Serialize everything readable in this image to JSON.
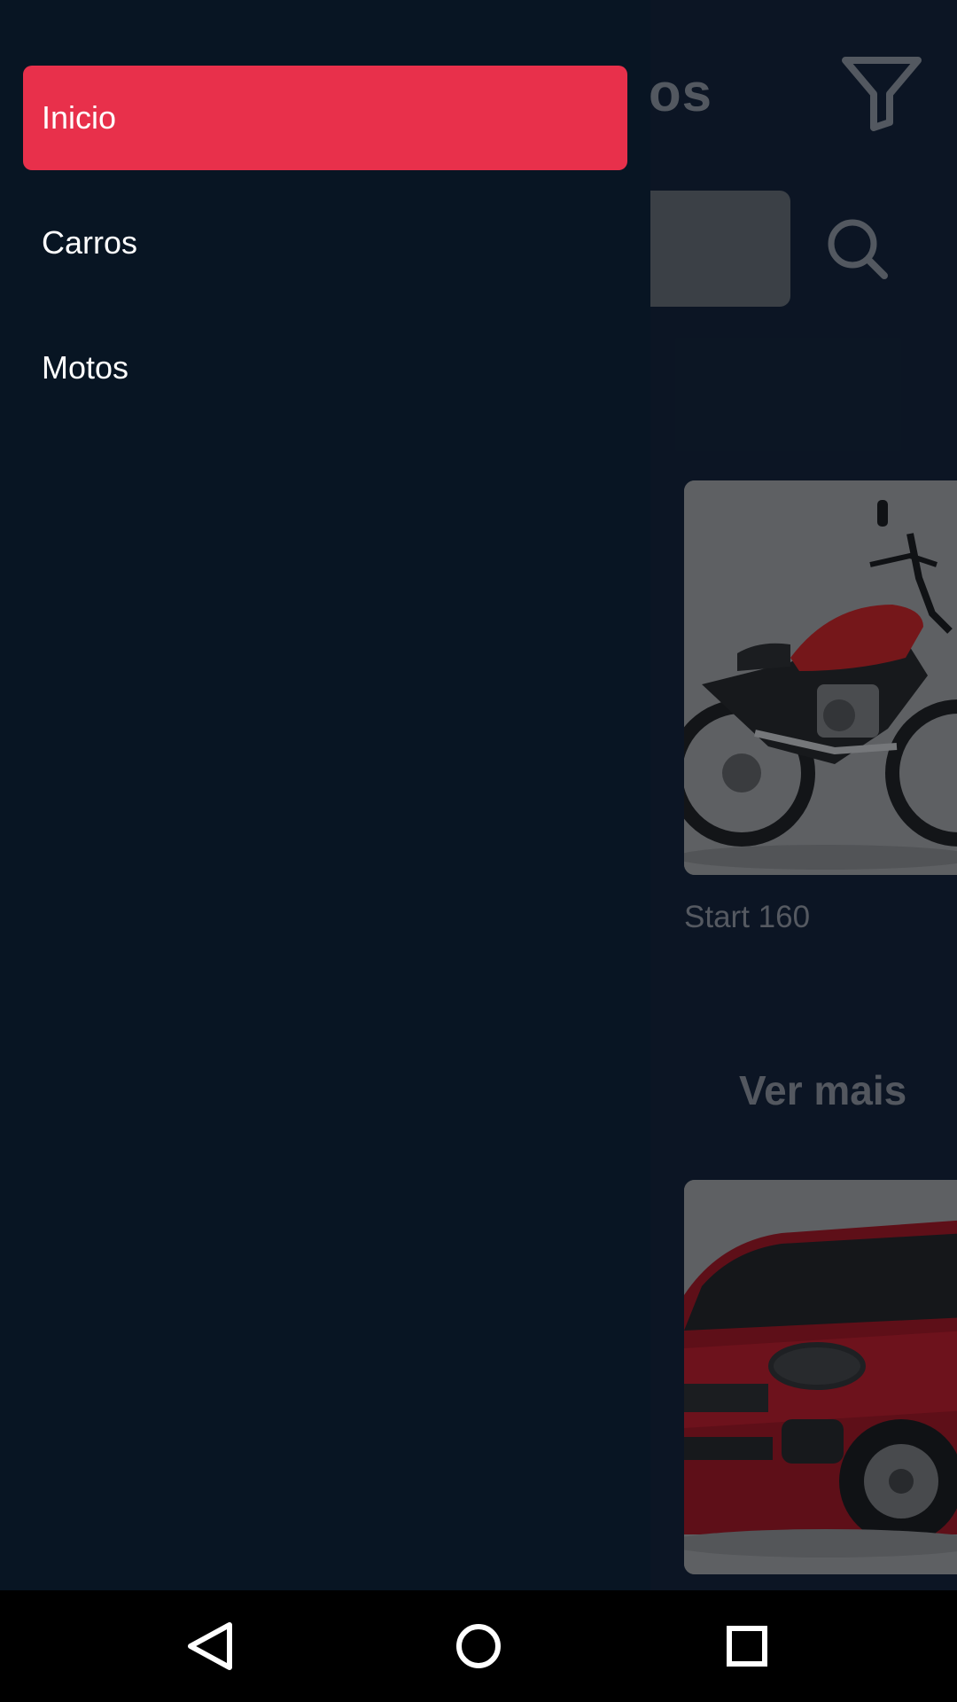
{
  "header": {
    "title": "os"
  },
  "drawer": {
    "items": [
      {
        "label": "Inicio",
        "active": true
      },
      {
        "label": "Carros",
        "active": false
      },
      {
        "label": "Motos",
        "active": false
      }
    ],
    "accent_color": "#e8304b"
  },
  "cards": [
    {
      "label": "Start 160",
      "image": "motorcycle-image"
    },
    {
      "label": "",
      "image": "car-image"
    }
  ],
  "section": {
    "more_label": "Ver mais"
  },
  "icons": {
    "filter": "filter-icon",
    "search": "search-icon",
    "back": "back-icon",
    "home": "home-icon",
    "recents": "recents-icon"
  }
}
